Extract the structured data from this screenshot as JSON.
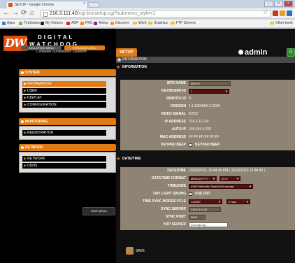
{
  "browser": {
    "tab_title": "SETUP - Google Chrome",
    "tab_subtitle": "SETUP",
    "url_host": "216.3.111.40",
    "url_path": "/cgi-bin/setup.cgi?submenu_style=1",
    "bookmarks": [
      "Apps",
      "Tinybeans",
      "My Verizon",
      "ADP",
      "PNC",
      "Aetna",
      "Discover",
      "Work",
      "Graphics",
      "FTP Servers",
      "Other book"
    ]
  },
  "header": {
    "logo_badge": "DW",
    "logo_line1": "DIGITAL",
    "logo_line2": "WATCHDOG",
    "logo_sub": "Complete Surveillance Solutions",
    "menu_tabs": [
      "COLLAPSED MENU",
      "EXPANDED MENU"
    ],
    "setup_tab": "SETUP",
    "user": "admin",
    "logout_label": "O"
  },
  "sidebar": {
    "system": {
      "title": "SYSTEM",
      "items": [
        "INFORMATION",
        "USER",
        "DISPLAY",
        "CONFIGURATION"
      ]
    },
    "monitoring": {
      "title": "MONITORING",
      "items": [
        "REGISTRATION"
      ]
    },
    "network": {
      "title": "NETWORK",
      "items": [
        "NETWORK",
        "DDNS"
      ]
    },
    "hide_menu": "HIDE MENU"
  },
  "main": {
    "breadcrumb": "INFORMATION",
    "info_section": "INFORMATION",
    "info_rows": [
      {
        "label": "SITE NAME",
        "value": "BROT1"
      },
      {
        "label": "KEYBOARD ID",
        "value": "1"
      },
      {
        "label": "REMOTE ID",
        "value": "0"
      },
      {
        "label": "VERSION",
        "value": "1.1.500N/R6.2.0DW"
      },
      {
        "label": "VIDEO SIGNAL",
        "value": "NTSC"
      },
      {
        "label": "IP ADDRESS",
        "value": "216.3.111.40"
      },
      {
        "label": "AUTO IP",
        "value": "169.254.4.233"
      },
      {
        "label": "MAC ADDRESS",
        "value": "FF:FF:FF:FF:FF:FF"
      },
      {
        "label": "KEYPAD BEEP",
        "value": "KEYPAD BEEP"
      }
    ],
    "datetime_section": "DATE/TIME",
    "datetime_rows": {
      "datetime": {
        "label": "DATE/TIME",
        "value": "10/23/2015, 12:44:46 PM   ( 10/23/2015   12:44:46  )"
      },
      "format": {
        "label": "DATE/TIME FORMAT",
        "value": "MM/DD/YYYY",
        "value2": "24 H"
      },
      "timezone": {
        "label": "TIMEZONE",
        "value": "(GMT-8)Pacific Time(US&Canada)"
      },
      "dst": {
        "label": "DAY LIGHT SAVING",
        "value": "USE DST"
      },
      "sync": {
        "label": "TIME SYNC MODE/CYCLE",
        "value": "CLIENT",
        "value2": "1 hour"
      },
      "server": {
        "label": "SYNC SERVER",
        "value": "216.3.111.39"
      },
      "port": {
        "label": "SYNC PORT",
        "value": "8002"
      },
      "ntp": {
        "label": "NTP SERVER",
        "value": "pool.ntp.org"
      }
    },
    "save_label": "SAVE"
  },
  "colors": {
    "accent": "#e17a12",
    "panel": "#8f8473",
    "select": "#5a0f0f"
  }
}
